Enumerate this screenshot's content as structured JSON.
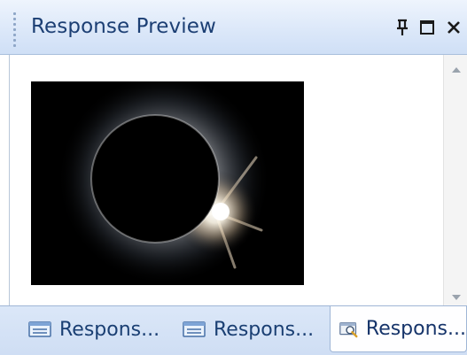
{
  "window": {
    "title": "Response Preview",
    "buttons": {
      "pin": "pin-icon",
      "maximize": "maximize-icon",
      "close": "close-icon"
    }
  },
  "preview": {
    "image": "solar-eclipse-diamond-ring"
  },
  "tabs": [
    {
      "label": "Respons...",
      "icon": "document-icon",
      "active": false
    },
    {
      "label": "Respons...",
      "icon": "document-icon",
      "active": false
    },
    {
      "label": "Respons...",
      "icon": "search-preview-icon",
      "active": true
    }
  ],
  "colors": {
    "title_text": "#1c3f74",
    "titlebar": "#dce8f9",
    "tab_text": "#1a3f73"
  }
}
